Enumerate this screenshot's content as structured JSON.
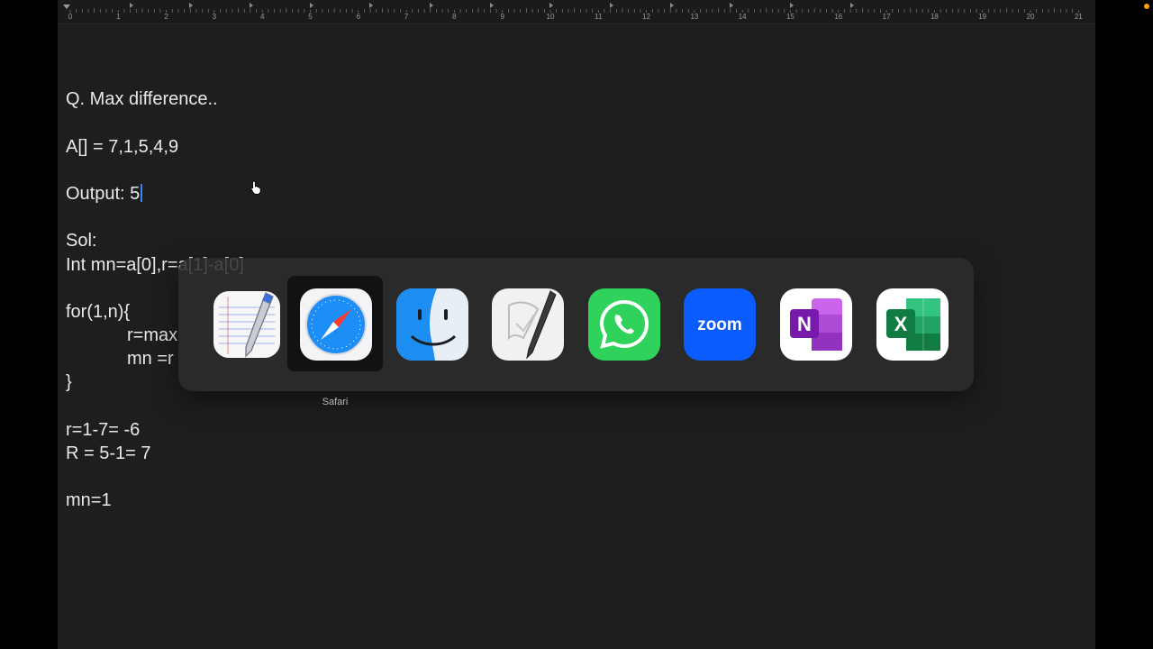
{
  "ruler": {
    "numbers": [
      "0",
      "1",
      "2",
      "3",
      "4",
      "5",
      "6",
      "7",
      "8",
      "9",
      "10",
      "11",
      "12",
      "13",
      "14",
      "15",
      "16",
      "17",
      "18",
      "19",
      "20",
      "21"
    ]
  },
  "document": {
    "lines": [
      {
        "text": ""
      },
      {
        "text": "Q. Max difference.."
      },
      {
        "text": ""
      },
      {
        "text": "A[] = 7,1,5,4,9"
      },
      {
        "text": ""
      },
      {
        "text": "Output: 5"
      },
      {
        "text": ""
      },
      {
        "text": "Sol:"
      },
      {
        "text": "Int mn=a[0],r=a[1]-a[0]"
      },
      {
        "text": ""
      },
      {
        "text": "for(1,n){"
      },
      {
        "text": "r=max",
        "indent": true
      },
      {
        "text": "mn =r",
        "indent": true
      },
      {
        "text": "}"
      },
      {
        "text": ""
      },
      {
        "text": "r=1-7= -6"
      },
      {
        "text": "R = 5-1= 7"
      },
      {
        "text": ""
      },
      {
        "text": "mn=1"
      }
    ]
  },
  "app_switcher": {
    "selected_label": "Safari",
    "apps": [
      {
        "name": "TextEdit",
        "icon": "textedit-icon"
      },
      {
        "name": "Safari",
        "icon": "safari-icon",
        "selected": true
      },
      {
        "name": "Finder",
        "icon": "finder-icon"
      },
      {
        "name": "Script Editor",
        "icon": "script-editor-icon"
      },
      {
        "name": "WhatsApp",
        "icon": "whatsapp-icon"
      },
      {
        "name": "Zoom",
        "icon": "zoom-icon",
        "logo_text": "zoom"
      },
      {
        "name": "OneNote",
        "icon": "onenote-icon",
        "logo_text": "N"
      },
      {
        "name": "Excel",
        "icon": "excel-icon",
        "logo_text": "X"
      }
    ]
  },
  "colors": {
    "editor_bg": "#1e1e1e",
    "text": "#e9e9e9",
    "caret": "#3b82f6",
    "recording_dot": "#ff9f0a"
  }
}
